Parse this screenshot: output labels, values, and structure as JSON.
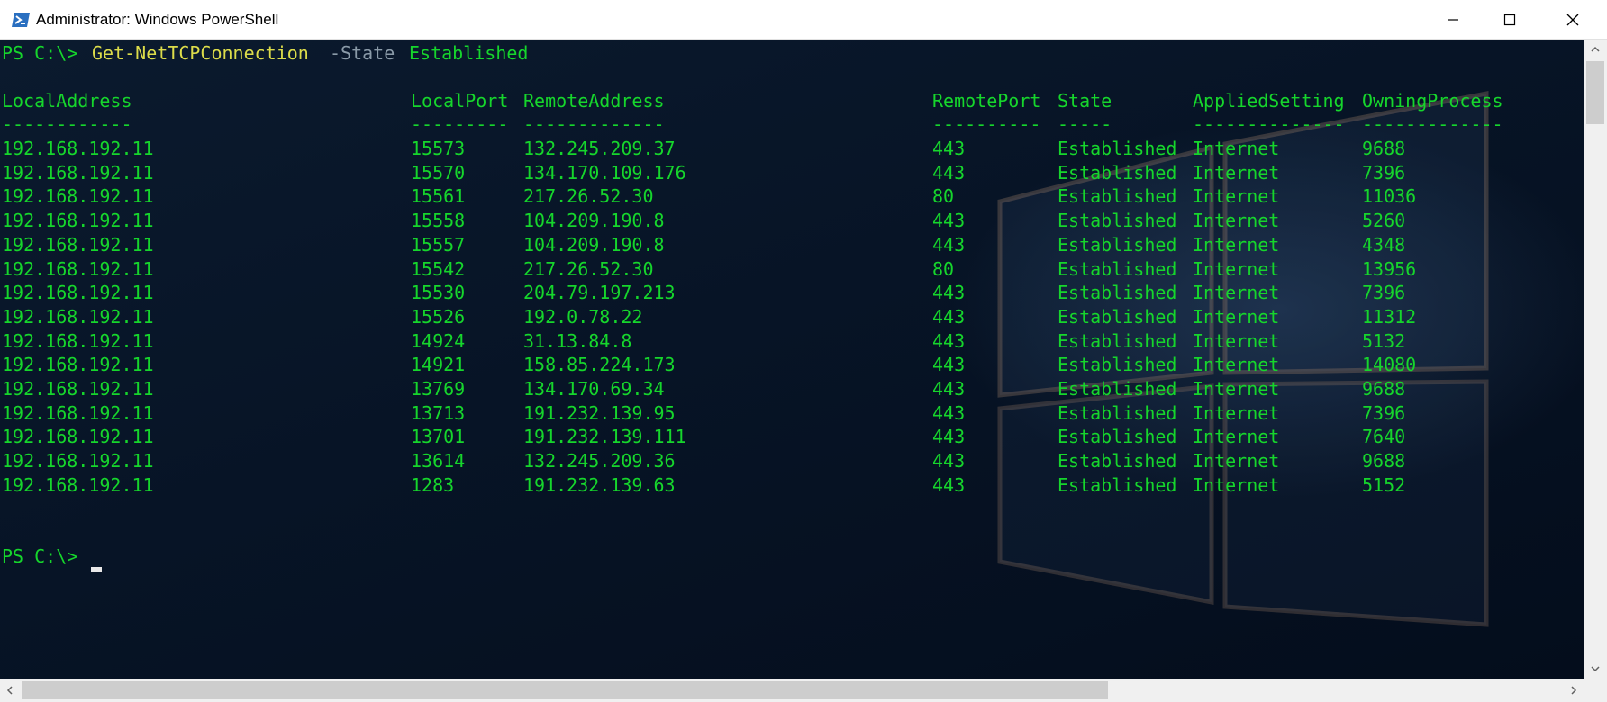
{
  "window": {
    "title": "Administrator: Windows PowerShell",
    "icons": {
      "app": "powershell-icon",
      "minimize": "minimize-icon",
      "maximize": "maximize-icon",
      "close": "close-icon"
    }
  },
  "colors": {
    "console_text": "#16d62c",
    "command": "#dcdc4a",
    "parameter": "#8a9aa8",
    "console_background": "#071426",
    "titlebar": "#ffffff"
  },
  "console": {
    "prompt": "PS C:\\>",
    "command": "Get-NetTCPConnection",
    "parameter": "-State",
    "argument": "Established",
    "headers": [
      "LocalAddress",
      "LocalPort",
      "RemoteAddress",
      "RemotePort",
      "State",
      "AppliedSetting",
      "OwningProcess"
    ],
    "separators": [
      "------------",
      "---------",
      "-------------",
      "----------",
      "-----",
      "--------------",
      "-------------"
    ],
    "rows": [
      [
        "192.168.192.11",
        "15573",
        "132.245.209.37",
        "443",
        "Established",
        "Internet",
        "9688"
      ],
      [
        "192.168.192.11",
        "15570",
        "134.170.109.176",
        "443",
        "Established",
        "Internet",
        "7396"
      ],
      [
        "192.168.192.11",
        "15561",
        "217.26.52.30",
        "80",
        "Established",
        "Internet",
        "11036"
      ],
      [
        "192.168.192.11",
        "15558",
        "104.209.190.8",
        "443",
        "Established",
        "Internet",
        "5260"
      ],
      [
        "192.168.192.11",
        "15557",
        "104.209.190.8",
        "443",
        "Established",
        "Internet",
        "4348"
      ],
      [
        "192.168.192.11",
        "15542",
        "217.26.52.30",
        "80",
        "Established",
        "Internet",
        "13956"
      ],
      [
        "192.168.192.11",
        "15530",
        "204.79.197.213",
        "443",
        "Established",
        "Internet",
        "7396"
      ],
      [
        "192.168.192.11",
        "15526",
        "192.0.78.22",
        "443",
        "Established",
        "Internet",
        "11312"
      ],
      [
        "192.168.192.11",
        "14924",
        "31.13.84.8",
        "443",
        "Established",
        "Internet",
        "5132"
      ],
      [
        "192.168.192.11",
        "14921",
        "158.85.224.173",
        "443",
        "Established",
        "Internet",
        "14080"
      ],
      [
        "192.168.192.11",
        "13769",
        "134.170.69.34",
        "443",
        "Established",
        "Internet",
        "9688"
      ],
      [
        "192.168.192.11",
        "13713",
        "191.232.139.95",
        "443",
        "Established",
        "Internet",
        "7396"
      ],
      [
        "192.168.192.11",
        "13701",
        "191.232.139.111",
        "443",
        "Established",
        "Internet",
        "7640"
      ],
      [
        "192.168.192.11",
        "13614",
        "132.245.209.36",
        "443",
        "Established",
        "Internet",
        "9688"
      ],
      [
        "192.168.192.11",
        "1283",
        "191.232.139.63",
        "443",
        "Established",
        "Internet",
        "5152"
      ]
    ]
  }
}
